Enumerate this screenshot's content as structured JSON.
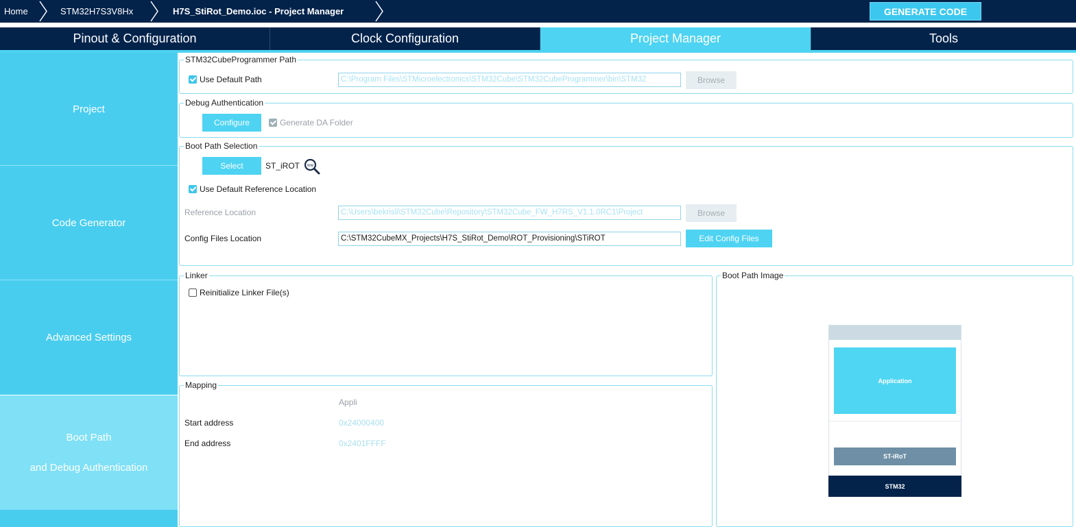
{
  "breadcrumb": {
    "home": "Home",
    "device": "STM32H7S3V8Hx",
    "project": "H7S_StiRot_Demo.ioc - Project Manager"
  },
  "generate_button": "GENERATE CODE",
  "tabs": [
    {
      "label": "Pinout & Configuration",
      "active": false
    },
    {
      "label": "Clock Configuration",
      "active": false
    },
    {
      "label": "Project Manager",
      "active": true
    },
    {
      "label": "Tools",
      "active": false
    }
  ],
  "sidebar": {
    "items": [
      {
        "label": "Project"
      },
      {
        "label": "Code Generator"
      },
      {
        "label": "Advanced Settings"
      },
      {
        "label": "Boot Path",
        "label2": "and Debug Authentication",
        "active": true
      }
    ]
  },
  "programmer": {
    "legend": "STM32CubeProgrammer Path",
    "use_default_label": "Use Default Path",
    "use_default_checked": true,
    "path": "C:\\Program Files\\STMicroelectronics\\STM32Cube\\STM32CubeProgrammer\\bin\\STM32",
    "browse": "Browse"
  },
  "debug_auth": {
    "legend": "Debug Authentication",
    "configure": "Configure",
    "generate_da_label": "Generate DA Folder",
    "generate_da_checked": true
  },
  "boot_path": {
    "legend": "Boot Path Selection",
    "select": "Select",
    "selected_value": "ST_iROT",
    "wiki_icon_label": "Wiki",
    "use_default_ref_label": "Use Default Reference Location",
    "use_default_ref_checked": true,
    "ref_location_label": "Reference Location",
    "ref_location": "C:\\Users\\bekrisli\\STM32Cube\\Repository\\STM32Cube_FW_H7RS_V1.1.0RC1\\Project",
    "ref_browse": "Browse",
    "config_files_label": "Config Files Location",
    "config_files": "C:\\STM32CubeMX_Projects\\H7S_StiRot_Demo\\ROT_Provisioning\\STiROT",
    "edit_config": "Edit Config Files"
  },
  "linker": {
    "legend": "Linker",
    "reinit_label": "Reinitialize Linker File(s)",
    "reinit_checked": false
  },
  "mapping": {
    "legend": "Mapping",
    "column": "Appli",
    "start_label": "Start address",
    "start_value": "0x24000400",
    "end_label": "End address",
    "end_value": "0x2401FFFF"
  },
  "boot_image": {
    "legend": "Boot Path Image",
    "application": "Application",
    "stirot": "ST-iRoT",
    "stm32": "STM32"
  },
  "colors": {
    "navy": "#03234b",
    "accent": "#4ed3f2",
    "sidebar_light": "#7fe0f6"
  }
}
